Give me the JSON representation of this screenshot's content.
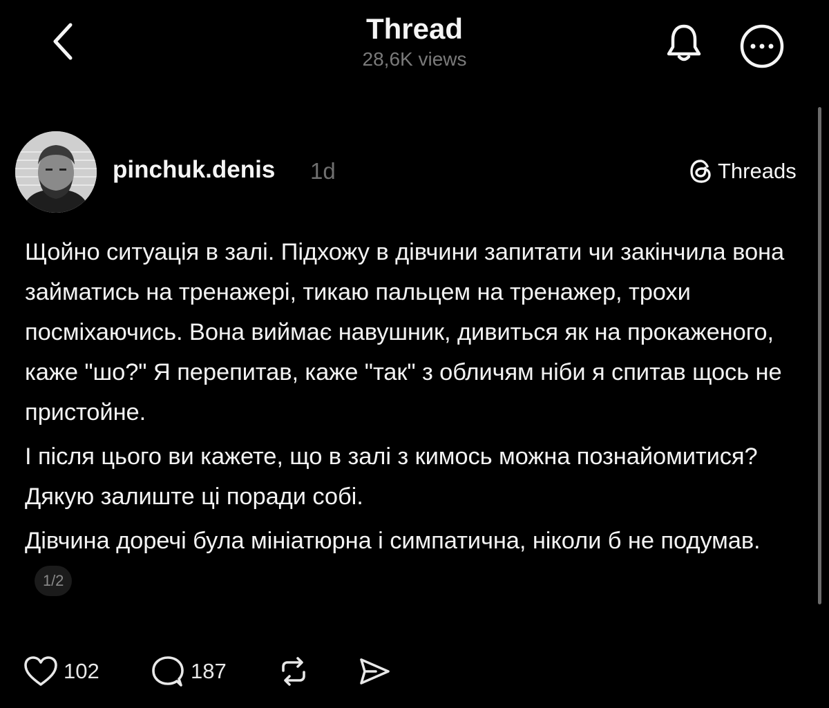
{
  "header": {
    "title": "Thread",
    "views": "28,6K views",
    "back_icon": "chevron-left-icon",
    "bell_icon": "bell-icon",
    "more_icon": "more-horizontal-icon"
  },
  "post": {
    "username": "pinchuk.denis",
    "time_ago": "1d",
    "source_label": "Threads",
    "avatar": "user-avatar-photo",
    "paragraphs": [
      "Щойно ситуація в залі. Підхожу в дівчини запитати чи закінчила вона займатись на тренажері, тикаю пальцем на тренажер, трохи посміхаючись. Вона виймає навушник, дивиться як на прокаженого, каже \"шо?\" Я перепитав, каже \"так\" з обличям ніби я спитав щось не пристойне.",
      "І після цього ви кажете, що в залі з кимось можна познайомитися? Дякую залиште ці поради собі.",
      "Дівчина доречі була мініатюрна і симпатична, ніколи б не подумав."
    ],
    "page_indicator": "1/2"
  },
  "actions": {
    "like_count": "102",
    "reply_count": "187",
    "like_icon": "heart-icon",
    "reply_icon": "comment-icon",
    "repost_icon": "repost-icon",
    "share_icon": "send-icon"
  },
  "colors": {
    "background": "#000000",
    "text": "#f3f3f3",
    "muted": "#7a7a7a"
  }
}
